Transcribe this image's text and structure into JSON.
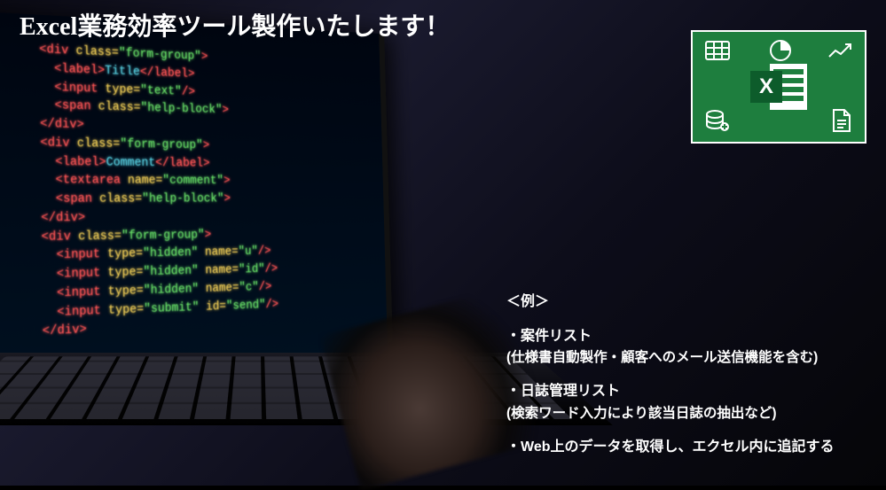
{
  "title": {
    "bold": "Excel",
    "rest": "業務効率ツール製作いたします！"
  },
  "excel_badge": {
    "letter": "X"
  },
  "code": {
    "lines": [
      [
        [
          "t-red",
          "<div "
        ],
        [
          "t-yellow",
          "class="
        ],
        [
          "t-green",
          "\"form-group\""
        ],
        [
          "t-red",
          ">"
        ]
      ],
      [
        [
          "t-gray",
          "  "
        ],
        [
          "t-red",
          "<label>"
        ],
        [
          "t-cyan",
          "Title"
        ],
        [
          "t-red",
          "</label>"
        ]
      ],
      [
        [
          "t-gray",
          "  "
        ],
        [
          "t-red",
          "<input "
        ],
        [
          "t-yellow",
          "type="
        ],
        [
          "t-green",
          "\"text\""
        ],
        [
          "t-red",
          "/>"
        ]
      ],
      [
        [
          "t-gray",
          "  "
        ],
        [
          "t-red",
          "<span "
        ],
        [
          "t-yellow",
          "class="
        ],
        [
          "t-green",
          "\"help-block\""
        ],
        [
          "t-red",
          ">"
        ]
      ],
      [
        [
          "t-red",
          "</div>"
        ]
      ],
      [
        [
          "t-red",
          "<div "
        ],
        [
          "t-yellow",
          "class="
        ],
        [
          "t-green",
          "\"form-group\""
        ],
        [
          "t-red",
          ">"
        ]
      ],
      [
        [
          "t-gray",
          "  "
        ],
        [
          "t-red",
          "<label>"
        ],
        [
          "t-cyan",
          "Comment"
        ],
        [
          "t-red",
          "</label>"
        ]
      ],
      [
        [
          "t-gray",
          "  "
        ],
        [
          "t-red",
          "<textarea "
        ],
        [
          "t-yellow",
          "name="
        ],
        [
          "t-green",
          "\"comment\""
        ],
        [
          "t-red",
          ">"
        ]
      ],
      [
        [
          "t-gray",
          "  "
        ],
        [
          "t-red",
          "<span "
        ],
        [
          "t-yellow",
          "class="
        ],
        [
          "t-green",
          "\"help-block\""
        ],
        [
          "t-red",
          ">"
        ]
      ],
      [
        [
          "t-red",
          "</div>"
        ]
      ],
      [
        [
          "t-red",
          "<div "
        ],
        [
          "t-yellow",
          "class="
        ],
        [
          "t-green",
          "\"form-group\""
        ],
        [
          "t-red",
          ">"
        ]
      ],
      [
        [
          "t-gray",
          "  "
        ],
        [
          "t-red",
          "<input "
        ],
        [
          "t-yellow",
          "type="
        ],
        [
          "t-green",
          "\"hidden\" "
        ],
        [
          "t-yellow",
          "name="
        ],
        [
          "t-green",
          "\"u\""
        ],
        [
          "t-red",
          "/>"
        ]
      ],
      [
        [
          "t-gray",
          "  "
        ],
        [
          "t-red",
          "<input "
        ],
        [
          "t-yellow",
          "type="
        ],
        [
          "t-green",
          "\"hidden\" "
        ],
        [
          "t-yellow",
          "name="
        ],
        [
          "t-green",
          "\"id\""
        ],
        [
          "t-red",
          "/>"
        ]
      ],
      [
        [
          "t-gray",
          "  "
        ],
        [
          "t-red",
          "<input "
        ],
        [
          "t-yellow",
          "type="
        ],
        [
          "t-green",
          "\"hidden\" "
        ],
        [
          "t-yellow",
          "name="
        ],
        [
          "t-green",
          "\"c\""
        ],
        [
          "t-red",
          "/>"
        ]
      ],
      [
        [
          "t-gray",
          "  "
        ],
        [
          "t-red",
          "<input "
        ],
        [
          "t-yellow",
          "type="
        ],
        [
          "t-green",
          "\"submit\" "
        ],
        [
          "t-yellow",
          "id="
        ],
        [
          "t-green",
          "\"send\""
        ],
        [
          "t-red",
          "/>"
        ]
      ],
      [
        [
          "t-red",
          "</div>"
        ]
      ]
    ]
  },
  "examples": {
    "heading": "＜例＞",
    "items": [
      {
        "title": "・案件リスト",
        "sub": "(仕様書自動製作・顧客へのメール送信機能を含む)"
      },
      {
        "title": "・日誌管理リスト",
        "sub": "(検索ワード入力により該当日誌の抽出など)"
      },
      {
        "title": "・Web上のデータを取得し、エクセル内に追記する",
        "sub": ""
      }
    ]
  }
}
